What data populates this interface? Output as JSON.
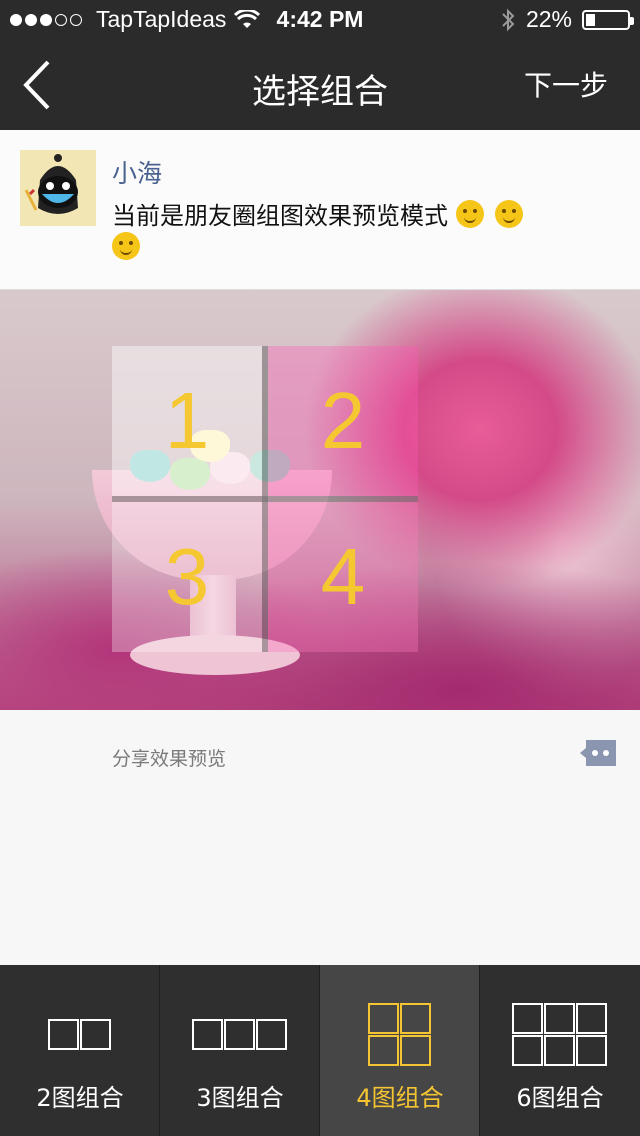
{
  "status_bar": {
    "carrier": "TapTapIdeas",
    "time": "4:42 PM",
    "battery": "22%",
    "battery_level": 0.22
  },
  "nav": {
    "title": "选择组合",
    "next_label": "下一步"
  },
  "post": {
    "username": "小海",
    "text": "当前是朋友圈组图效果预览模式"
  },
  "grid": {
    "cells": [
      "1",
      "2",
      "3",
      "4"
    ]
  },
  "share": {
    "label": "分享效果预览"
  },
  "tabs": [
    {
      "label": "2图组合"
    },
    {
      "label": "3图组合"
    },
    {
      "label": "4图组合"
    },
    {
      "label": "6图组合"
    }
  ],
  "colors": {
    "bar_bg": "#2b2b2b",
    "accent": "#f4c433",
    "name_blue": "#4a6290"
  }
}
